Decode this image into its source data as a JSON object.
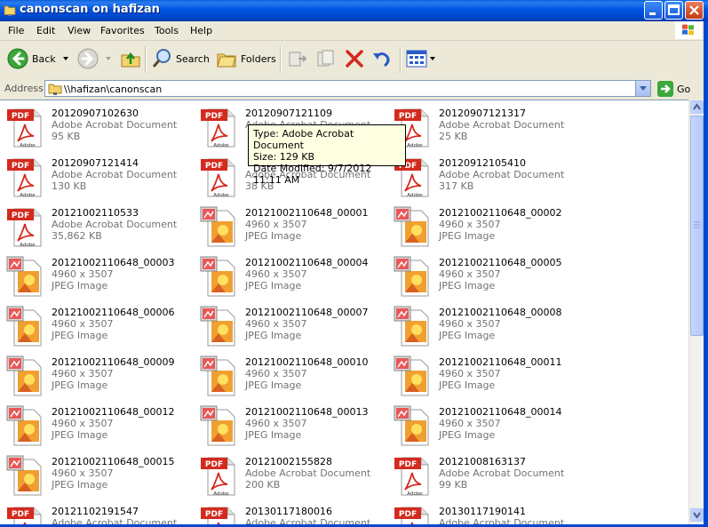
{
  "window": {
    "title": "canonscan on hafizan"
  },
  "menu": [
    "File",
    "Edit",
    "View",
    "Favorites",
    "Tools",
    "Help"
  ],
  "toolbar": {
    "back": "Back",
    "search": "Search",
    "folders": "Folders"
  },
  "address": {
    "label": "Address",
    "path": "\\\\hafizan\\canonscan",
    "go": "Go"
  },
  "tooltip": {
    "type": "Type: Adobe Acrobat Document",
    "size": "Size: 129 KB",
    "modified": "Date Modified: 9/7/2012 11:11 AM"
  },
  "files": [
    {
      "name": "20120907102630",
      "line2": "Adobe Acrobat Document",
      "line3": "95 KB",
      "icon": "pdf-icon"
    },
    {
      "name": "20120907121109",
      "line2": "Adobe Acrobat Document",
      "line3": "",
      "icon": "pdf-icon"
    },
    {
      "name": "20120907121317",
      "line2": "Adobe Acrobat Document",
      "line3": "25 KB",
      "icon": "pdf-icon"
    },
    {
      "name": "20120907121414",
      "line2": "Adobe Acrobat Document",
      "line3": "130 KB",
      "icon": "pdf-icon"
    },
    {
      "name": "",
      "line2": "Adobe Acrobat Document",
      "line3": "38 KB",
      "icon": "pdf-icon"
    },
    {
      "name": "20120912105410",
      "line2": "Adobe Acrobat Document",
      "line3": "317 KB",
      "icon": "pdf-icon"
    },
    {
      "name": "20121002110533",
      "line2": "Adobe Acrobat Document",
      "line3": "35,862 KB",
      "icon": "pdf-icon"
    },
    {
      "name": "20121002110648_00001",
      "line2": "4960 x 3507",
      "line3": "JPEG Image",
      "icon": "jpeg-icon"
    },
    {
      "name": "20121002110648_00002",
      "line2": "4960 x 3507",
      "line3": "JPEG Image",
      "icon": "jpeg-icon"
    },
    {
      "name": "20121002110648_00003",
      "line2": "4960 x 3507",
      "line3": "JPEG Image",
      "icon": "jpeg-icon"
    },
    {
      "name": "20121002110648_00004",
      "line2": "4960 x 3507",
      "line3": "JPEG Image",
      "icon": "jpeg-icon"
    },
    {
      "name": "20121002110648_00005",
      "line2": "4960 x 3507",
      "line3": "JPEG Image",
      "icon": "jpeg-icon"
    },
    {
      "name": "20121002110648_00006",
      "line2": "4960 x 3507",
      "line3": "JPEG Image",
      "icon": "jpeg-icon"
    },
    {
      "name": "20121002110648_00007",
      "line2": "4960 x 3507",
      "line3": "JPEG Image",
      "icon": "jpeg-icon"
    },
    {
      "name": "20121002110648_00008",
      "line2": "4960 x 3507",
      "line3": "JPEG Image",
      "icon": "jpeg-icon"
    },
    {
      "name": "20121002110648_00009",
      "line2": "4960 x 3507",
      "line3": "JPEG Image",
      "icon": "jpeg-icon"
    },
    {
      "name": "20121002110648_00010",
      "line2": "4960 x 3507",
      "line3": "JPEG Image",
      "icon": "jpeg-icon"
    },
    {
      "name": "20121002110648_00011",
      "line2": "4960 x 3507",
      "line3": "JPEG Image",
      "icon": "jpeg-icon"
    },
    {
      "name": "20121002110648_00012",
      "line2": "4960 x 3507",
      "line3": "JPEG Image",
      "icon": "jpeg-icon"
    },
    {
      "name": "20121002110648_00013",
      "line2": "4960 x 3507",
      "line3": "JPEG Image",
      "icon": "jpeg-icon"
    },
    {
      "name": "20121002110648_00014",
      "line2": "4960 x 3507",
      "line3": "JPEG Image",
      "icon": "jpeg-icon"
    },
    {
      "name": "20121002110648_00015",
      "line2": "4960 x 3507",
      "line3": "JPEG Image",
      "icon": "jpeg-icon"
    },
    {
      "name": "20121002155828",
      "line2": "Adobe Acrobat Document",
      "line3": "200 KB",
      "icon": "pdf-icon"
    },
    {
      "name": "20121008163137",
      "line2": "Adobe Acrobat Document",
      "line3": "99 KB",
      "icon": "pdf-icon"
    },
    {
      "name": "20121102191547",
      "line2": "Adobe Acrobat Document",
      "line3": "",
      "icon": "pdf-icon"
    },
    {
      "name": "20130117180016",
      "line2": "Adobe Acrobat Document",
      "line3": "",
      "icon": "pdf-icon"
    },
    {
      "name": "20130117190141",
      "line2": "Adobe Acrobat Document",
      "line3": "",
      "icon": "pdf-icon"
    }
  ],
  "colors": {
    "titlebar": "#0054e3",
    "pdf_red": "#d42a1e",
    "tooltip_bg": "#ffffe1"
  }
}
